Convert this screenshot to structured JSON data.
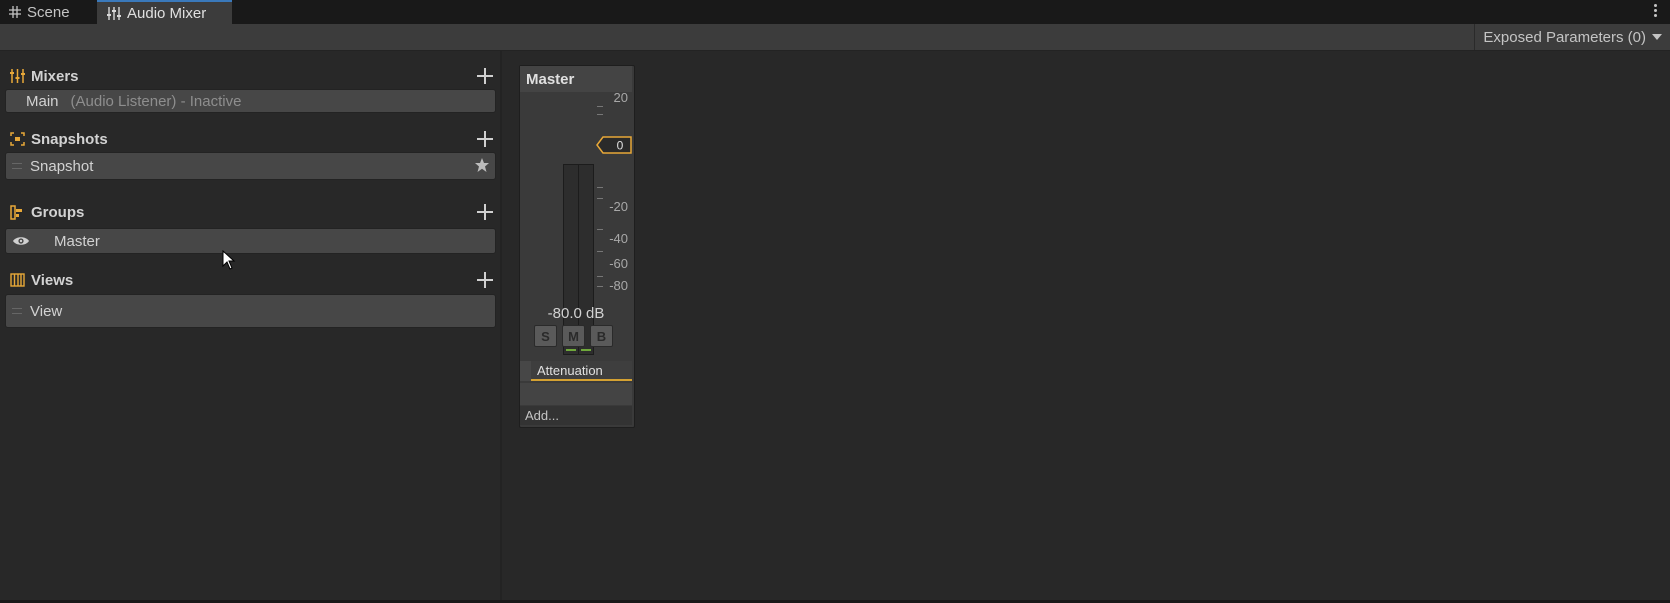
{
  "tabs": [
    {
      "label": "Scene",
      "icon": "grid-icon",
      "active": false
    },
    {
      "label": "Audio Mixer",
      "icon": "mixer-icon",
      "active": true
    }
  ],
  "toolbar": {
    "exposed_parameters_label": "Exposed Parameters (0)"
  },
  "sidebar": {
    "mixers": {
      "title": "Mixers",
      "items": [
        {
          "name": "Main",
          "status": "(Audio Listener) - Inactive"
        }
      ]
    },
    "snapshots": {
      "title": "Snapshots",
      "items": [
        {
          "name": "Snapshot",
          "starred": true
        }
      ]
    },
    "groups": {
      "title": "Groups",
      "items": [
        {
          "name": "Master",
          "visible": true
        }
      ]
    },
    "views": {
      "title": "Views",
      "items": [
        {
          "name": "View"
        }
      ]
    }
  },
  "strip": {
    "title": "Master",
    "scale_labels": [
      "20",
      "-20",
      "-40",
      "-60",
      "-80"
    ],
    "fader_value": "0",
    "level_db": "-80.0 dB",
    "buttons": {
      "solo": "S",
      "mute": "M",
      "bypass": "B"
    },
    "effect": "Attenuation",
    "add_label": "Add..."
  },
  "colors": {
    "accent": "#d4a132",
    "tab_highlight": "#3a79bb",
    "meter_green": "#6fa83b"
  }
}
